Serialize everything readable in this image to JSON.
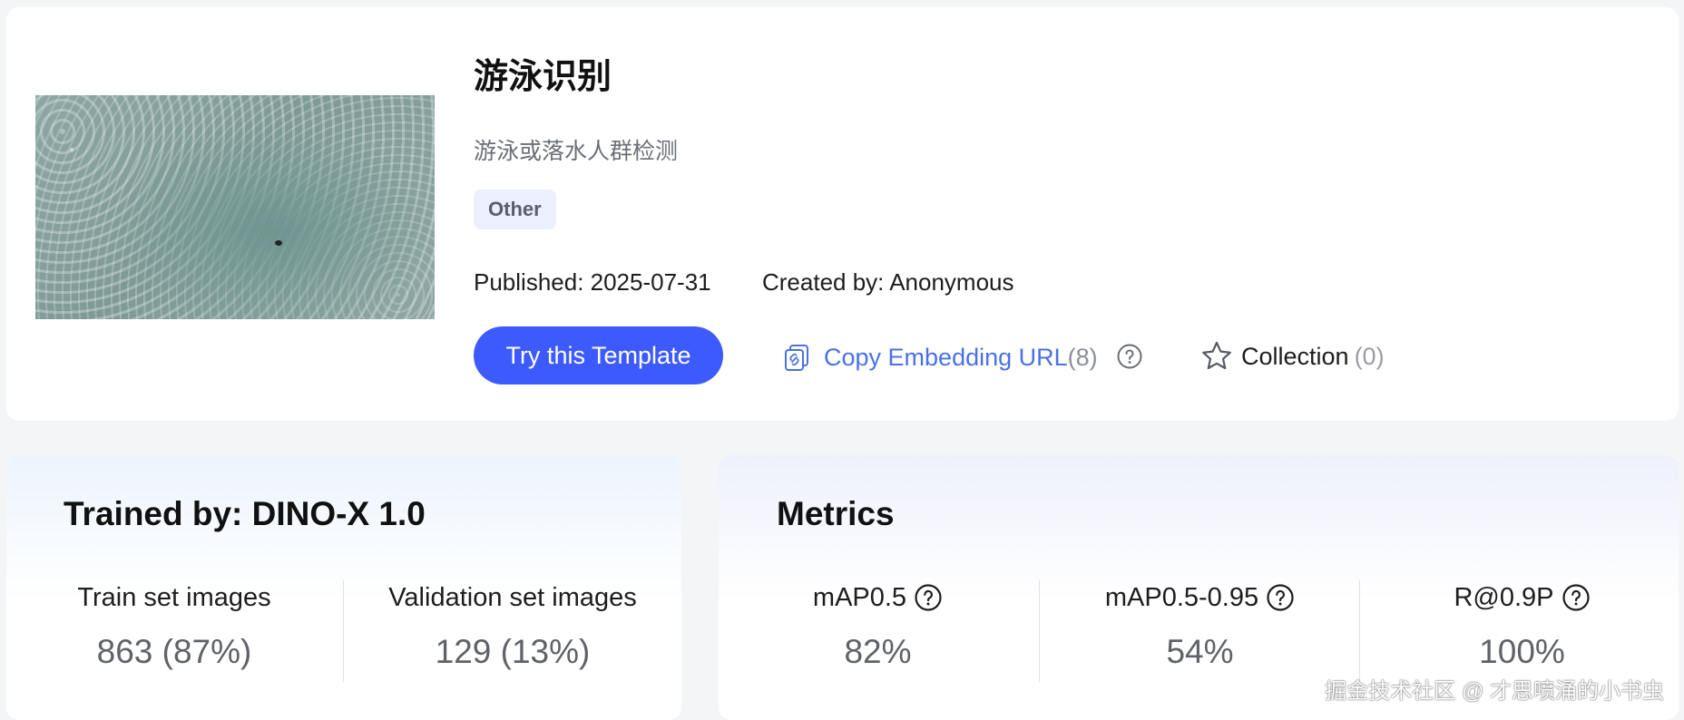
{
  "template": {
    "title": "游泳识别",
    "subtitle": "游泳或落水人群检测",
    "tag": "Other",
    "published": "Published: 2025-07-31",
    "created_by": "Created by: Anonymous",
    "try_button": "Try this Template",
    "copy_url_label": "Copy Embedding URL",
    "copy_url_count": "(8)",
    "collection_label": "Collection",
    "collection_count": "(0)"
  },
  "training": {
    "title": "Trained by: DINO-X 1.0",
    "train_label": "Train set images",
    "train_value": "863 (87%)",
    "val_label": "Validation set images",
    "val_value": "129 (13%)"
  },
  "metrics": {
    "title": "Metrics",
    "items": [
      {
        "label": "mAP0.5",
        "value": "82%"
      },
      {
        "label": "mAP0.5-0.95",
        "value": "54%"
      },
      {
        "label": "R@0.9P",
        "value": "100%"
      }
    ]
  },
  "watermark": "掘金技术社区 @ 才思喷涌的小书虫",
  "colors": {
    "accent": "#3d5afe",
    "link": "#4a70e8",
    "tag_bg": "#eceffe"
  }
}
